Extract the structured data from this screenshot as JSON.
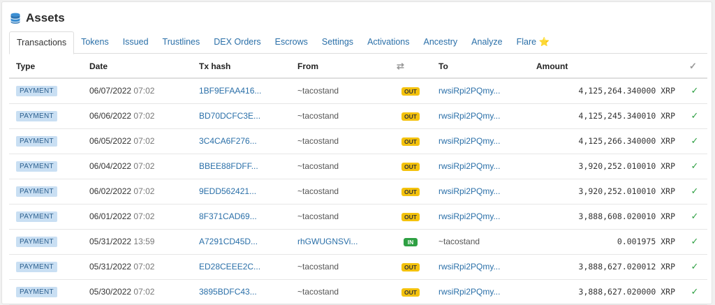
{
  "header": {
    "title": "Assets",
    "icon": "database-stack-icon"
  },
  "tabs": [
    {
      "label": "Transactions",
      "active": true
    },
    {
      "label": "Tokens"
    },
    {
      "label": "Issued"
    },
    {
      "label": "Trustlines"
    },
    {
      "label": "DEX Orders"
    },
    {
      "label": "Escrows"
    },
    {
      "label": "Settings"
    },
    {
      "label": "Activations"
    },
    {
      "label": "Ancestry"
    },
    {
      "label": "Analyze"
    },
    {
      "label": "Flare ⭐"
    }
  ],
  "table": {
    "columns": {
      "type": "Type",
      "date": "Date",
      "tx_hash": "Tx hash",
      "from": "From",
      "direction_icon": "⇄",
      "to": "To",
      "amount": "Amount",
      "status_icon": "✓"
    },
    "rows": [
      {
        "type": "PAYMENT",
        "date": "06/07/2022",
        "time": "07:02",
        "hash": "1BF9EFAA416...",
        "from": "~tacostand",
        "from_link": false,
        "dir": "OUT",
        "to": "rwsiRpi2PQmy...",
        "to_link": true,
        "amount": "4,125,264.340000 XRP"
      },
      {
        "type": "PAYMENT",
        "date": "06/06/2022",
        "time": "07:02",
        "hash": "BD70DCFC3E...",
        "from": "~tacostand",
        "from_link": false,
        "dir": "OUT",
        "to": "rwsiRpi2PQmy...",
        "to_link": true,
        "amount": "4,125,245.340010 XRP"
      },
      {
        "type": "PAYMENT",
        "date": "06/05/2022",
        "time": "07:02",
        "hash": "3C4CA6F276...",
        "from": "~tacostand",
        "from_link": false,
        "dir": "OUT",
        "to": "rwsiRpi2PQmy...",
        "to_link": true,
        "amount": "4,125,266.340000 XRP"
      },
      {
        "type": "PAYMENT",
        "date": "06/04/2022",
        "time": "07:02",
        "hash": "BBEE88FDFF...",
        "from": "~tacostand",
        "from_link": false,
        "dir": "OUT",
        "to": "rwsiRpi2PQmy...",
        "to_link": true,
        "amount": "3,920,252.010010 XRP"
      },
      {
        "type": "PAYMENT",
        "date": "06/02/2022",
        "time": "07:02",
        "hash": "9EDD562421...",
        "from": "~tacostand",
        "from_link": false,
        "dir": "OUT",
        "to": "rwsiRpi2PQmy...",
        "to_link": true,
        "amount": "3,920,252.010010 XRP"
      },
      {
        "type": "PAYMENT",
        "date": "06/01/2022",
        "time": "07:02",
        "hash": "8F371CAD69...",
        "from": "~tacostand",
        "from_link": false,
        "dir": "OUT",
        "to": "rwsiRpi2PQmy...",
        "to_link": true,
        "amount": "3,888,608.020010 XRP"
      },
      {
        "type": "PAYMENT",
        "date": "05/31/2022",
        "time": "13:59",
        "hash": "A7291CD45D...",
        "from": "rhGWUGNSVi...",
        "from_link": true,
        "dir": "IN",
        "to": "~tacostand",
        "to_link": false,
        "amount": "0.001975 XRP"
      },
      {
        "type": "PAYMENT",
        "date": "05/31/2022",
        "time": "07:02",
        "hash": "ED28CEEE2C...",
        "from": "~tacostand",
        "from_link": false,
        "dir": "OUT",
        "to": "rwsiRpi2PQmy...",
        "to_link": true,
        "amount": "3,888,627.020012 XRP"
      },
      {
        "type": "PAYMENT",
        "date": "05/30/2022",
        "time": "07:02",
        "hash": "3895BDFC43...",
        "from": "~tacostand",
        "from_link": false,
        "dir": "OUT",
        "to": "rwsiRpi2PQmy...",
        "to_link": true,
        "amount": "3,888,627.020000 XRP"
      }
    ]
  },
  "colors": {
    "link": "#2a6fa8",
    "out_badge": "#f4c20d",
    "in_badge": "#2ea043",
    "type_badge": "#c9dff3",
    "check": "#2ea043"
  }
}
